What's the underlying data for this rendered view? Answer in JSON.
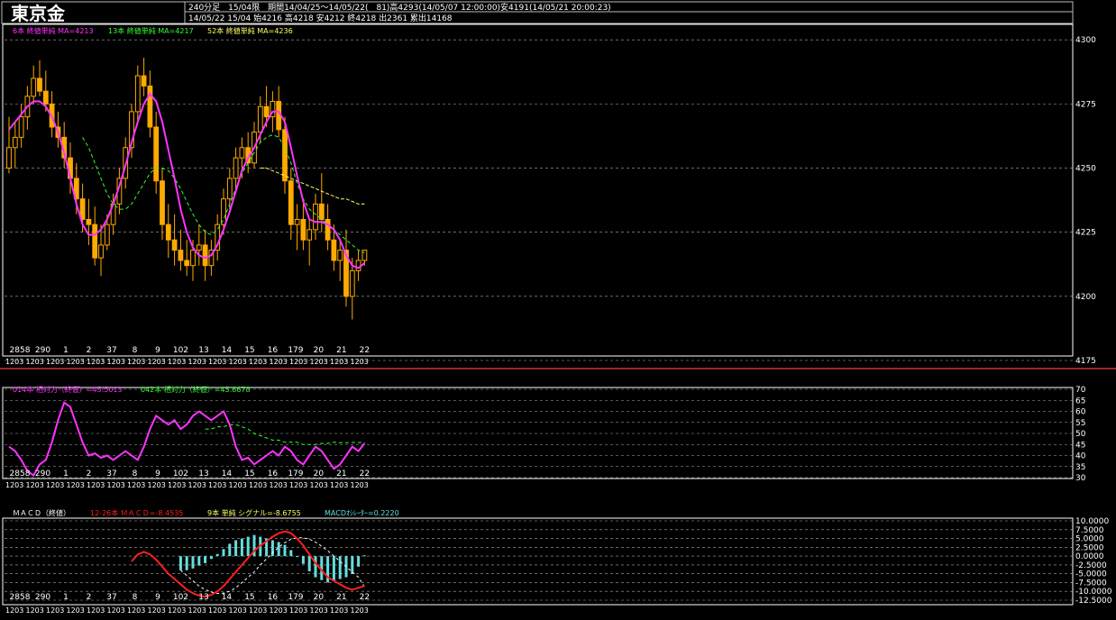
{
  "header": {
    "symbol": "東京金",
    "line1": "240分足　15/04限　期間14/04/25～14/05/22(　81)高4293(14/05/07 12:00:00)安4191(14/05/21 20:00:23)",
    "line2": "14/05/22 15/04 始4216 高4218 安4212 終4218 出2361 累出14168"
  },
  "colors": {
    "background": "#000000",
    "candle": "#ffaa00",
    "ma6": "#ff33ff",
    "ma13": "#33ff33",
    "ma52": "#ffff66",
    "rsi14": "#ff33ff",
    "rsi42": "#33ff33",
    "macd": "#ff2020",
    "signal": "#ffffff",
    "histogram": "#66dddd",
    "separator": "#cc3333",
    "grid": "#aaaaaa"
  },
  "x_axis": {
    "day_labels": [
      "2858",
      "290",
      "1",
      "2",
      "37",
      "8",
      "9",
      "102",
      "13",
      "14",
      "15",
      "16",
      "179",
      "20",
      "21",
      "22"
    ],
    "year_label": "1203"
  },
  "price_panel": {
    "legend": [
      {
        "text": "6本 終値単純 MA=4213",
        "color": "#ff33ff"
      },
      {
        "text": "13本 終値単純 MA=4217",
        "color": "#33ff33"
      },
      {
        "text": "52本 終値単純 MA=4236",
        "color": "#ffff66"
      }
    ],
    "y_ticks": [
      "4300",
      "4275",
      "4250",
      "4225",
      "4200",
      "4175"
    ]
  },
  "rsi_panel": {
    "legend": [
      {
        "text": "014本 相対力（終値）=45.5013",
        "color": "#ff33ff"
      },
      {
        "text": "042本 相対力（終値）=45.8678",
        "color": "#33ff33"
      }
    ],
    "y_ticks": [
      "70",
      "65",
      "60",
      "55",
      "50",
      "45",
      "40",
      "35",
      "30"
    ]
  },
  "macd_panel": {
    "legend": [
      {
        "text": "ＭＡＣＤ（終値）",
        "color": "#ffffff"
      },
      {
        "text": "12-26本 ＭＡＣＤ=-8.4535",
        "color": "#ff2020"
      },
      {
        "text": "9本 単純 シグナル=-8.6755",
        "color": "#ffff66"
      },
      {
        "text": "MACDｵｼﾚｰﾀｰ=0.2220",
        "color": "#66dddd"
      }
    ],
    "y_ticks": [
      "10.0000",
      "7.5000",
      "5.0000",
      "2.5000",
      "0.0000",
      "-2.5000",
      "-5.0000",
      "-7.5000",
      "-10.0000",
      "-12.5000"
    ]
  },
  "chart_data": [
    {
      "type": "candlestick",
      "title": "東京金",
      "ylim": [
        4175,
        4305
      ],
      "candles": [
        [
          4250,
          4270,
          4248,
          4258
        ],
        [
          4258,
          4268,
          4250,
          4262
        ],
        [
          4262,
          4275,
          4258,
          4270
        ],
        [
          4270,
          4282,
          4265,
          4278
        ],
        [
          4278,
          4290,
          4275,
          4285
        ],
        [
          4285,
          4292,
          4278,
          4280
        ],
        [
          4280,
          4288,
          4272,
          4275
        ],
        [
          4275,
          4280,
          4262,
          4266
        ],
        [
          4266,
          4272,
          4258,
          4262
        ],
        [
          4262,
          4268,
          4250,
          4254
        ],
        [
          4254,
          4260,
          4240,
          4246
        ],
        [
          4246,
          4252,
          4232,
          4238
        ],
        [
          4238,
          4244,
          4225,
          4230
        ],
        [
          4230,
          4238,
          4220,
          4228
        ],
        [
          4228,
          4235,
          4212,
          4215
        ],
        [
          4215,
          4228,
          4208,
          4220
        ],
        [
          4220,
          4232,
          4218,
          4228
        ],
        [
          4228,
          4240,
          4224,
          4236
        ],
        [
          4236,
          4250,
          4232,
          4246
        ],
        [
          4246,
          4262,
          4242,
          4258
        ],
        [
          4258,
          4275,
          4254,
          4272
        ],
        [
          4272,
          4290,
          4268,
          4286
        ],
        [
          4286,
          4293,
          4278,
          4282
        ],
        [
          4282,
          4288,
          4262,
          4266
        ],
        [
          4266,
          4272,
          4240,
          4245
        ],
        [
          4245,
          4250,
          4222,
          4228
        ],
        [
          4228,
          4236,
          4215,
          4222
        ],
        [
          4222,
          4232,
          4212,
          4218
        ],
        [
          4218,
          4226,
          4210,
          4214
        ],
        [
          4214,
          4222,
          4208,
          4212
        ],
        [
          4212,
          4222,
          4206,
          4218
        ],
        [
          4218,
          4228,
          4212,
          4220
        ],
        [
          4220,
          4226,
          4206,
          4212
        ],
        [
          4212,
          4222,
          4208,
          4218
        ],
        [
          4218,
          4232,
          4214,
          4228
        ],
        [
          4228,
          4242,
          4224,
          4238
        ],
        [
          4238,
          4250,
          4234,
          4246
        ],
        [
          4246,
          4258,
          4240,
          4254
        ],
        [
          4254,
          4262,
          4246,
          4258
        ],
        [
          4258,
          4264,
          4248,
          4252
        ],
        [
          4252,
          4268,
          4250,
          4264
        ],
        [
          4264,
          4278,
          4260,
          4274
        ],
        [
          4274,
          4282,
          4266,
          4270
        ],
        [
          4270,
          4280,
          4264,
          4276
        ],
        [
          4276,
          4282,
          4262,
          4265
        ],
        [
          4265,
          4270,
          4240,
          4245
        ],
        [
          4245,
          4250,
          4222,
          4228
        ],
        [
          4228,
          4236,
          4218,
          4230
        ],
        [
          4230,
          4236,
          4218,
          4222
        ],
        [
          4222,
          4230,
          4212,
          4226
        ],
        [
          4226,
          4240,
          4222,
          4236
        ],
        [
          4236,
          4248,
          4225,
          4230
        ],
        [
          4230,
          4236,
          4218,
          4222
        ],
        [
          4222,
          4228,
          4210,
          4214
        ],
        [
          4214,
          4222,
          4206,
          4218
        ],
        [
          4218,
          4226,
          4196,
          4200
        ],
        [
          4200,
          4215,
          4191,
          4210
        ],
        [
          4210,
          4218,
          4206,
          4214
        ],
        [
          4214,
          4218,
          4212,
          4218
        ]
      ],
      "ma6": [
        4265,
        4268,
        4271,
        4274,
        4276,
        4276,
        4274,
        4270,
        4264,
        4256,
        4246,
        4236,
        4228,
        4224,
        4224,
        4226,
        4230,
        4236,
        4243,
        4251,
        4260,
        4268,
        4275,
        4279,
        4276,
        4268,
        4257,
        4246,
        4234,
        4225,
        4219,
        4216,
        4215,
        4216,
        4220,
        4226,
        4233,
        4241,
        4249,
        4254,
        4258,
        4263,
        4268,
        4272,
        4272,
        4268,
        4258,
        4247,
        4237,
        4230,
        4229,
        4229,
        4228,
        4226,
        4222,
        4216,
        4212,
        4211,
        4213
      ],
      "ma13": [
        null,
        null,
        null,
        null,
        null,
        null,
        null,
        null,
        null,
        null,
        null,
        null,
        4262,
        4258,
        4252,
        4246,
        4240,
        4236,
        4234,
        4234,
        4236,
        4240,
        4244,
        4248,
        4250,
        4250,
        4249,
        4246,
        4242,
        4237,
        4232,
        4228,
        4225,
        4224,
        4226,
        4230,
        4236,
        4242,
        4248,
        4252,
        4256,
        4260,
        4262,
        4263,
        4262,
        4258,
        4252,
        4244,
        4238,
        4234,
        4232,
        4230,
        4228,
        4226,
        4224,
        4222,
        4220,
        4218,
        4217
      ],
      "ma52": [
        null,
        null,
        null,
        null,
        null,
        null,
        null,
        null,
        null,
        null,
        null,
        null,
        null,
        null,
        null,
        null,
        null,
        null,
        null,
        null,
        null,
        null,
        null,
        null,
        null,
        null,
        null,
        null,
        null,
        null,
        null,
        null,
        null,
        null,
        null,
        null,
        null,
        null,
        null,
        null,
        null,
        4250,
        4250,
        4249,
        4248,
        4247,
        4246,
        4245,
        4244,
        4243,
        4242,
        4241,
        4240,
        4239,
        4238,
        4238,
        4237,
        4236,
        4236
      ]
    },
    {
      "type": "line",
      "title": "相対力（終値）",
      "ylim": [
        30,
        70
      ],
      "series": [
        {
          "name": "014本 相対力（終値）",
          "values": [
            44,
            42,
            38,
            33,
            31,
            36,
            38,
            46,
            56,
            64,
            62,
            54,
            46,
            40,
            41,
            39,
            40,
            38,
            40,
            42,
            40,
            38,
            44,
            52,
            58,
            56,
            54,
            56,
            52,
            54,
            58,
            60,
            58,
            56,
            58,
            60,
            54,
            44,
            38,
            39,
            36,
            38,
            40,
            42,
            40,
            44,
            42,
            38,
            36,
            40,
            44,
            42,
            38,
            34,
            36,
            40,
            44,
            42,
            45.5
          ]
        },
        {
          "name": "042本 相対力（終値）",
          "values": [
            null,
            null,
            null,
            null,
            null,
            null,
            null,
            null,
            null,
            null,
            null,
            null,
            null,
            null,
            null,
            null,
            null,
            null,
            null,
            null,
            null,
            null,
            null,
            null,
            null,
            null,
            null,
            null,
            null,
            null,
            null,
            null,
            52,
            52,
            53,
            53,
            54,
            54,
            53,
            52,
            50,
            49,
            48,
            47,
            47,
            46,
            46,
            46,
            45,
            45,
            45,
            45.5,
            45.5,
            46,
            45.8,
            45.8,
            45.9,
            45.9,
            45.9
          ]
        }
      ]
    },
    {
      "type": "bar+line",
      "title": "ＭＡＣＤ（終値）",
      "ylim": [
        -12.5,
        10
      ],
      "series": [
        {
          "name": "12-26本 ＭＡＣＤ",
          "values": [
            null,
            null,
            null,
            null,
            null,
            null,
            null,
            null,
            null,
            null,
            null,
            null,
            null,
            null,
            null,
            null,
            null,
            null,
            null,
            null,
            -1.5,
            0.5,
            1.2,
            0.5,
            -1.0,
            -3.0,
            -5.0,
            -6.5,
            -8.0,
            -9.5,
            -10.5,
            -11.2,
            -11.5,
            -11.0,
            -10.0,
            -8.5,
            -6.5,
            -4.5,
            -2.5,
            -0.5,
            1.5,
            3.0,
            4.2,
            5.5,
            6.5,
            7.0,
            6.5,
            5.0,
            3.0,
            0.5,
            -2.0,
            -4.0,
            -6.0,
            -7.0,
            -8.0,
            -9.0,
            -9.5,
            -9.0,
            -8.45
          ]
        },
        {
          "name": "9本 単純 シグナル",
          "values": [
            null,
            null,
            null,
            null,
            null,
            null,
            null,
            null,
            null,
            null,
            null,
            null,
            null,
            null,
            null,
            null,
            null,
            null,
            null,
            null,
            null,
            null,
            null,
            null,
            null,
            null,
            null,
            null,
            -4.0,
            -5.5,
            -7.0,
            -8.5,
            -9.5,
            -10.2,
            -10.6,
            -10.5,
            -10.0,
            -9.0,
            -7.5,
            -6.0,
            -4.5,
            -2.5,
            -0.8,
            1.0,
            2.5,
            3.8,
            4.8,
            5.2,
            5.2,
            4.8,
            4.0,
            2.8,
            1.5,
            0.0,
            -1.5,
            -3.0,
            -4.5,
            -6.0,
            -8.68
          ]
        },
        {
          "name": "MACDｵｼﾚｰﾀｰ",
          "values": [
            null,
            null,
            null,
            null,
            null,
            null,
            null,
            null,
            null,
            null,
            null,
            null,
            null,
            null,
            null,
            null,
            null,
            null,
            null,
            null,
            null,
            null,
            null,
            null,
            null,
            null,
            null,
            null,
            -4.0,
            -4.0,
            -3.5,
            -2.7,
            -2.0,
            -0.8,
            0.6,
            2.0,
            3.5,
            4.5,
            5.0,
            5.5,
            6.0,
            5.5,
            5.0,
            4.5,
            4.0,
            3.2,
            1.7,
            -0.2,
            -2.2,
            -4.3,
            -6.0,
            -6.8,
            -7.5,
            -7.0,
            -6.5,
            -6.0,
            -5.0,
            -3.0,
            0.22
          ]
        }
      ]
    }
  ]
}
